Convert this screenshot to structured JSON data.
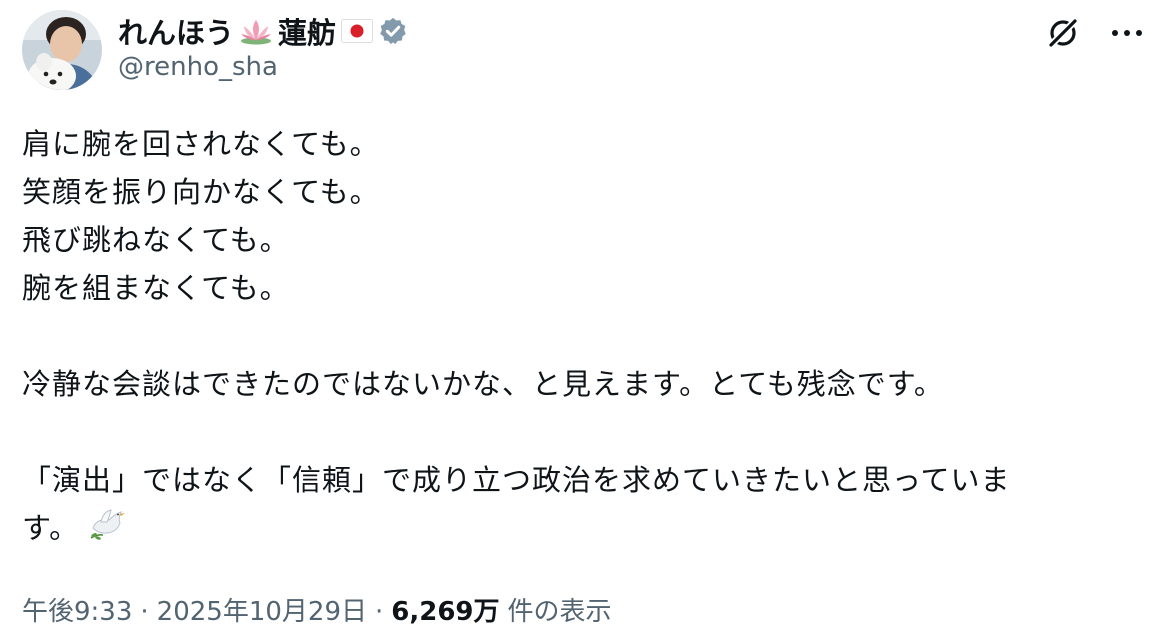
{
  "author": {
    "display_name": "れんほう",
    "display_name_2": "蓮舫",
    "handle": "@renho_sha",
    "verified": true,
    "emoji_1": "lotus-icon",
    "emoji_2": "japan-flag-icon"
  },
  "tweet": {
    "lines": [
      "肩に腕を回されなくても。",
      "笑顔を振り向かなくても。",
      "飛び跳ねなくても。",
      "腕を組まなくても。",
      "",
      "冷静な会談はできたのではないかな、と見えます。とても残念です。",
      "",
      "「演出」ではなく「信頼」で成り立つ政治を求めていきたいと思っていま",
      "す。"
    ],
    "trailing_emoji": "dove-icon"
  },
  "meta": {
    "time": "午後9:33",
    "separator": "·",
    "date": "2025年10月29日",
    "views_count": "6,269万",
    "views_label": "件の表示"
  },
  "colors": {
    "text": "#0f1419",
    "secondary": "#536471",
    "verified_badge": "#829aab"
  }
}
